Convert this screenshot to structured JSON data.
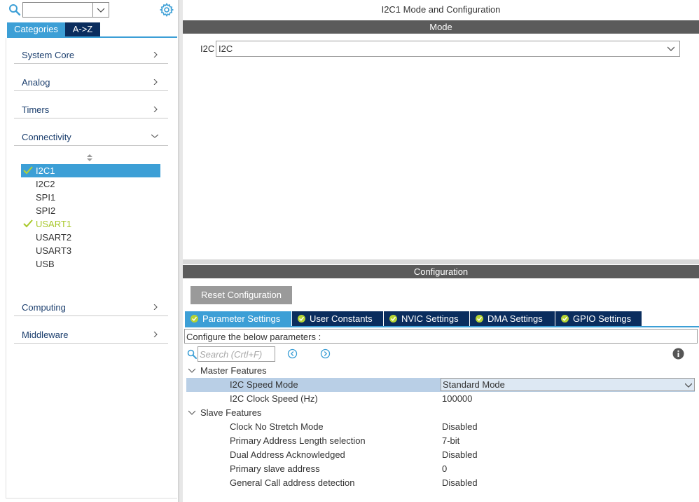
{
  "left": {
    "tabs": {
      "categories": "Categories",
      "az": "A->Z"
    },
    "categories": [
      {
        "label": "System Core",
        "expanded": false
      },
      {
        "label": "Analog",
        "expanded": false
      },
      {
        "label": "Timers",
        "expanded": false
      },
      {
        "label": "Connectivity",
        "expanded": true
      },
      {
        "label": "Computing",
        "expanded": false
      },
      {
        "label": "Middleware",
        "expanded": false
      }
    ],
    "peripherals": [
      {
        "label": "I2C1",
        "selected": true,
        "configured": true
      },
      {
        "label": "I2C2",
        "selected": false,
        "configured": false
      },
      {
        "label": "SPI1",
        "selected": false,
        "configured": false
      },
      {
        "label": "SPI2",
        "selected": false,
        "configured": false
      },
      {
        "label": "USART1",
        "selected": false,
        "configured": true
      },
      {
        "label": "USART2",
        "selected": false,
        "configured": false
      },
      {
        "label": "USART3",
        "selected": false,
        "configured": false
      },
      {
        "label": "USB",
        "selected": false,
        "configured": false
      }
    ]
  },
  "right": {
    "window_title": "I2C1 Mode and Configuration",
    "mode": {
      "header": "Mode",
      "field_label": "I2C",
      "field_value": "I2C"
    },
    "configuration": {
      "header": "Configuration",
      "reset_button": "Reset Configuration",
      "tabs": [
        {
          "label": "Parameter Settings",
          "active": true
        },
        {
          "label": "User Constants",
          "active": false
        },
        {
          "label": "NVIC Settings",
          "active": false
        },
        {
          "label": "DMA Settings",
          "active": false
        },
        {
          "label": "GPIO Settings",
          "active": false
        }
      ],
      "instructions": "Configure the below parameters :",
      "search_placeholder": "Search (Crtl+F)",
      "groups": [
        {
          "label": "Master Features",
          "params": [
            {
              "name": "I2C Speed Mode",
              "value": "Standard Mode",
              "editing": true
            },
            {
              "name": "I2C Clock Speed (Hz)",
              "value": "100000"
            }
          ]
        },
        {
          "label": "Slave Features",
          "params": [
            {
              "name": "Clock No Stretch Mode",
              "value": "Disabled"
            },
            {
              "name": "Primary Address Length selection",
              "value": "7-bit"
            },
            {
              "name": "Dual Address Acknowledged",
              "value": "Disabled"
            },
            {
              "name": "Primary slave address",
              "value": "0"
            },
            {
              "name": "General Call address detection",
              "value": "Disabled"
            }
          ]
        }
      ]
    }
  },
  "colors": {
    "accent_blue": "#3c9fd6",
    "navy": "#0a2d5e",
    "band_gray": "#5b5b5b",
    "check_green": "#a8c82a",
    "row_highlight": "#b9cfe6"
  }
}
